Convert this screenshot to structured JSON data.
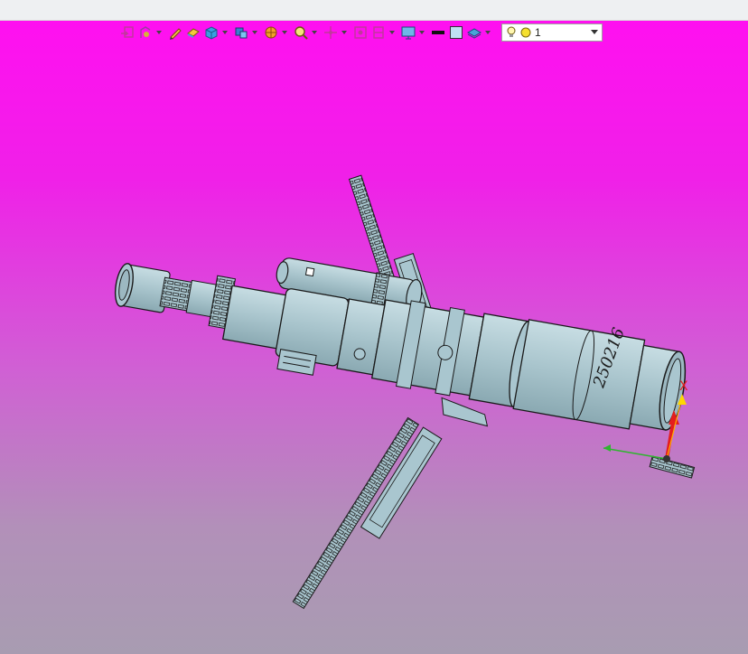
{
  "toolbar": {
    "buttons": [
      {
        "id": "snap-view",
        "icon": "snap-view-icon",
        "has_dropdown": false
      },
      {
        "id": "rotate-model",
        "icon": "rotate-model-icon",
        "has_dropdown": true
      },
      {
        "id": "pencil-sketch",
        "icon": "pencil-icon",
        "has_dropdown": false
      },
      {
        "id": "eraser",
        "icon": "eraser-icon",
        "has_dropdown": false
      },
      {
        "id": "solid-view",
        "icon": "cube-icon",
        "has_dropdown": true
      },
      {
        "id": "multi-view",
        "icon": "view-orientation-icon",
        "has_dropdown": true
      },
      {
        "id": "render-style",
        "icon": "render-style-icon",
        "has_dropdown": true
      },
      {
        "id": "zoom",
        "icon": "zoom-icon",
        "has_dropdown": true
      },
      {
        "id": "origin",
        "icon": "origin-icon",
        "has_dropdown": true
      },
      {
        "id": "fit-view",
        "icon": "fit-view-icon",
        "has_dropdown": false
      },
      {
        "id": "section-view",
        "icon": "section-view-icon",
        "has_dropdown": true
      },
      {
        "id": "display-settings",
        "icon": "display-settings-icon",
        "has_dropdown": true
      },
      {
        "id": "line-color",
        "icon": "line-color-icon",
        "has_dropdown": false
      },
      {
        "id": "fill-color",
        "icon": "fill-color-icon",
        "has_dropdown": false
      },
      {
        "id": "layer-manager",
        "icon": "layer-icon",
        "has_dropdown": true
      }
    ],
    "layer_select": {
      "value": "1",
      "icons": [
        "lightbulb-icon",
        "layer-circle-icon"
      ]
    }
  },
  "triad": {
    "axis_label": "X"
  },
  "model": {
    "engraving": "250216"
  },
  "colors": {
    "viewport_top": "#ff10f0",
    "viewport_bottom": "#a89cb1",
    "body": "#a9c6cf",
    "outline": "#1a1a1a",
    "axis_x": "#e41e1e",
    "axis_y": "#2fb52f",
    "axis_z": "#ffd700"
  }
}
